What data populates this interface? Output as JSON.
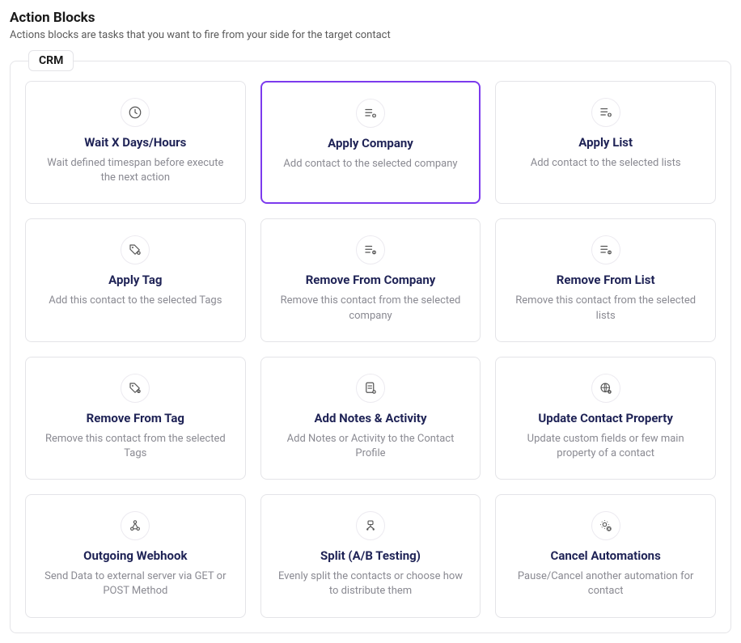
{
  "section": {
    "title": "Action Blocks",
    "description": "Actions blocks are tasks that you want to fire from your side for the target contact"
  },
  "group": {
    "label": "CRM"
  },
  "cards": [
    {
      "icon": "clock-icon",
      "title": "Wait X Days/Hours",
      "description": "Wait defined timespan before execute the next action",
      "selected": false
    },
    {
      "icon": "list-add-icon",
      "title": "Apply Company",
      "description": "Add contact to the selected company",
      "selected": true
    },
    {
      "icon": "list-add-icon",
      "title": "Apply List",
      "description": "Add contact to the selected lists",
      "selected": false
    },
    {
      "icon": "tag-add-icon",
      "title": "Apply Tag",
      "description": "Add this contact to the selected Tags",
      "selected": false
    },
    {
      "icon": "list-remove-icon",
      "title": "Remove From Company",
      "description": "Remove this contact from the selected company",
      "selected": false
    },
    {
      "icon": "list-remove-icon",
      "title": "Remove From List",
      "description": "Remove this contact from the selected lists",
      "selected": false
    },
    {
      "icon": "tag-remove-icon",
      "title": "Remove From Tag",
      "description": "Remove this contact from the selected Tags",
      "selected": false
    },
    {
      "icon": "note-add-icon",
      "title": "Add Notes & Activity",
      "description": "Add Notes or Activity to the Contact Profile",
      "selected": false
    },
    {
      "icon": "globe-gear-icon",
      "title": "Update Contact Property",
      "description": "Update custom fields or few main property of a contact",
      "selected": false
    },
    {
      "icon": "webhook-icon",
      "title": "Outgoing Webhook",
      "description": "Send Data to external server via GET or POST Method",
      "selected": false
    },
    {
      "icon": "split-icon",
      "title": "Split (A/B Testing)",
      "description": "Evenly split the contacts or choose how to distribute them",
      "selected": false
    },
    {
      "icon": "automation-cancel-icon",
      "title": "Cancel Automations",
      "description": "Pause/Cancel another automation for contact",
      "selected": false
    }
  ]
}
